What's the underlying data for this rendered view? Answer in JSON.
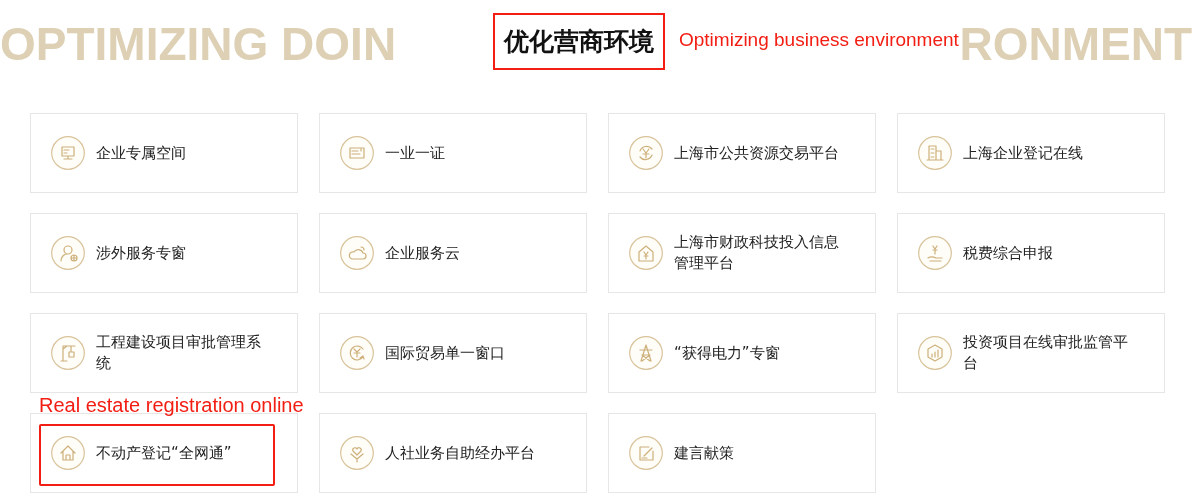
{
  "header": {
    "backdrop_left": "OPTIMIZING DOIN",
    "backdrop_right": "RONMENT",
    "title": "优化营商环境",
    "title_highlighted": true,
    "annotation": "Optimizing business environment"
  },
  "services": [
    {
      "label": "企业专属空间",
      "highlighted": false
    },
    {
      "label": "一业一证",
      "highlighted": false
    },
    {
      "label": "上海市公共资源交易平台",
      "highlighted": false
    },
    {
      "label": "上海企业登记在线",
      "highlighted": false
    },
    {
      "label": "涉外服务专窗",
      "highlighted": false
    },
    {
      "label": "企业服务云",
      "highlighted": false
    },
    {
      "label": "上海市财政科技投入信息管理平台",
      "highlighted": false
    },
    {
      "label": "税费综合申报",
      "highlighted": false
    },
    {
      "label": "工程建设项目审批管理系统",
      "highlighted": false
    },
    {
      "label": "国际贸易单一窗口",
      "highlighted": false
    },
    {
      "label": "“获得电力”专窗",
      "highlighted": false
    },
    {
      "label": "投资项目在线审批监管平台",
      "highlighted": false
    },
    {
      "label": "不动产登记“全网通”",
      "highlighted": true
    },
    {
      "label": "人社业务自助经办平台",
      "highlighted": false
    },
    {
      "label": "建言献策",
      "highlighted": false
    }
  ],
  "service_annotation": "Real estate registration online"
}
